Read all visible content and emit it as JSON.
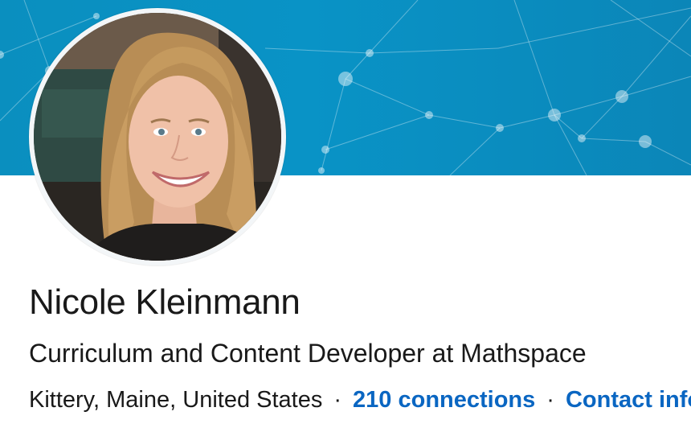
{
  "profile": {
    "name": "Nicole Kleinmann",
    "headline": "Curriculum and Content Developer at Mathspace",
    "location": "Kittery, Maine, United States",
    "separator": "·",
    "connections_label": "210 connections",
    "contact_info_label": "Contact info"
  },
  "icons": {
    "profile_photo": "profile-photo",
    "cover_background": "network-pattern"
  },
  "colors": {
    "banner": "#0993c6",
    "link": "#0a66c2",
    "text": "#191919",
    "avatar_border": "#f3f6f8"
  }
}
